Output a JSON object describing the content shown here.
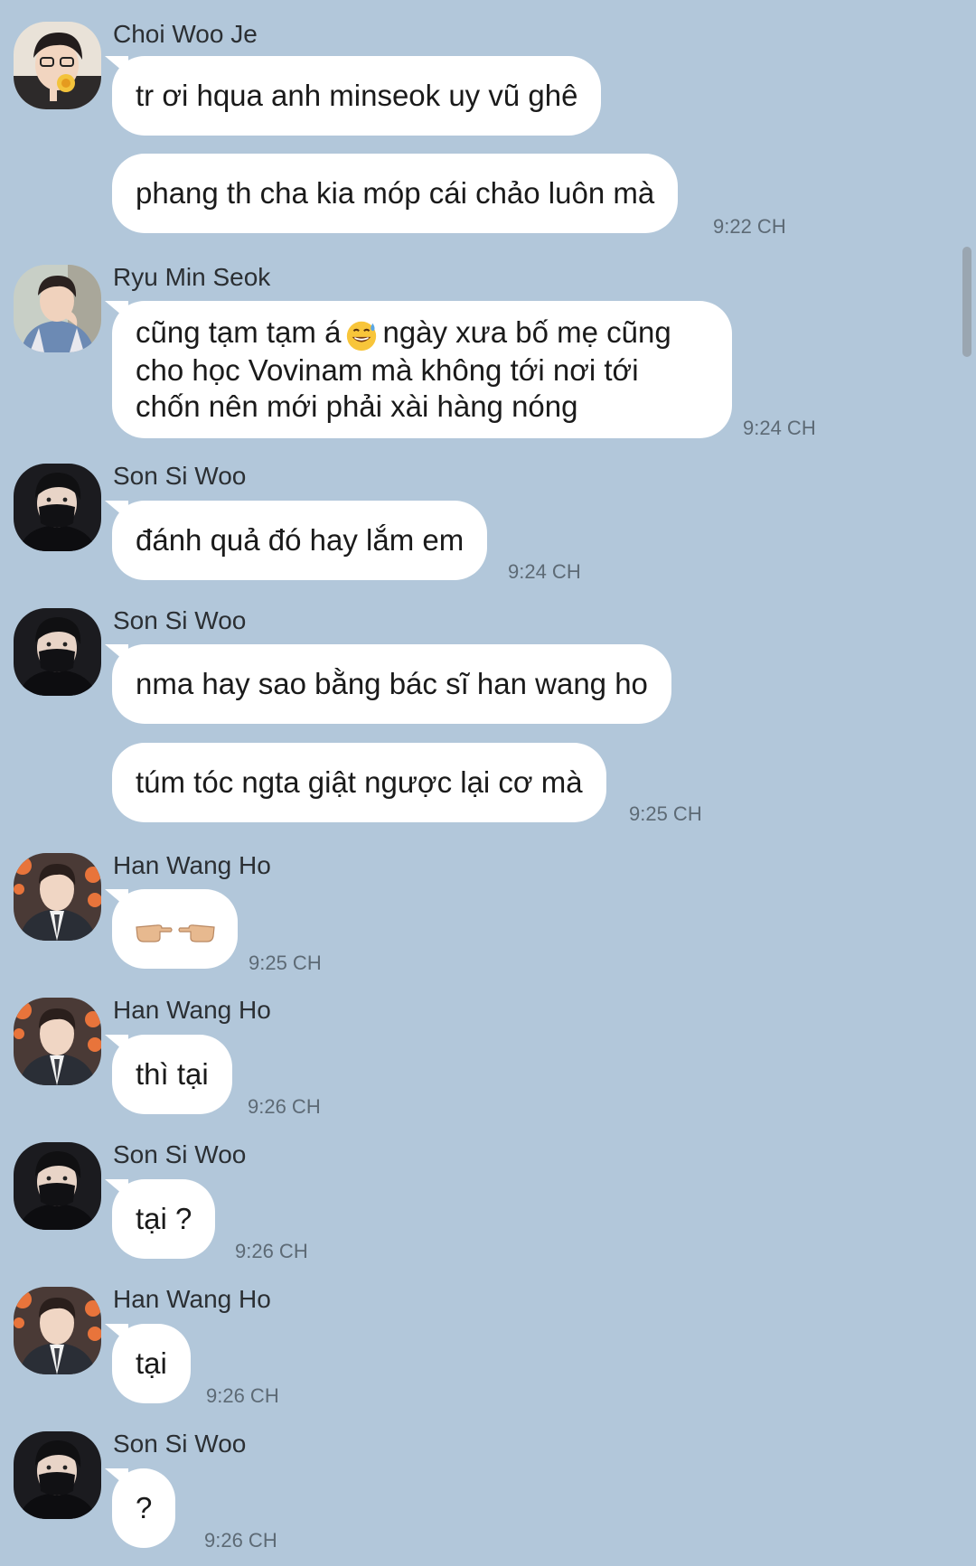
{
  "messages": [
    {
      "sender": "Choi Woo Je",
      "avatar": "choi-woo-je-avatar",
      "bubbles": [
        "tr ơi hqua anh minseok uy vũ ghê",
        "phang th cha kia móp cái chảo luôn mà"
      ],
      "time": "9:22 CH"
    },
    {
      "sender": "Ryu Min Seok",
      "avatar": "ryu-min-seok-avatar",
      "bubbles_before_emoji": "cũng tạm tạm á",
      "emoji": "grinning-sweat-emoji",
      "bubbles_after_emoji": "ngày xưa bố mẹ cũng cho học Vovinam mà không tới nơi tới chốn nên mới phải xài hàng nóng",
      "time": "9:24 CH"
    },
    {
      "sender": "Son Si Woo",
      "avatar": "son-si-woo-avatar",
      "bubbles": [
        "đánh quả đó hay lắm em"
      ],
      "time": "9:24 CH"
    },
    {
      "sender": "Son Si Woo",
      "avatar": "son-si-woo-avatar",
      "bubbles": [
        "nma hay sao bằng bác sĩ han wang ho",
        "túm tóc ngta giật ngược lại cơ mà"
      ],
      "time": "9:25 CH"
    },
    {
      "sender": "Han Wang Ho",
      "avatar": "han-wang-ho-avatar",
      "bubbles_emoji": "pointing-fingers-emoji",
      "time": "9:25 CH"
    },
    {
      "sender": "Han Wang Ho",
      "avatar": "han-wang-ho-avatar",
      "bubbles": [
        "thì tại"
      ],
      "time": "9:26 CH"
    },
    {
      "sender": "Son Si Woo",
      "avatar": "son-si-woo-avatar",
      "bubbles": [
        "tại ?"
      ],
      "time": "9:26 CH"
    },
    {
      "sender": "Han Wang Ho",
      "avatar": "han-wang-ho-avatar",
      "bubbles": [
        "tại"
      ],
      "time": "9:26 CH"
    },
    {
      "sender": "Son Si Woo",
      "avatar": "son-si-woo-avatar",
      "bubbles": [
        "?"
      ],
      "time": "9:26 CH"
    }
  ],
  "colors": {
    "background": "#b2c7da",
    "bubble": "#ffffff",
    "time_text": "#5d6a75"
  }
}
